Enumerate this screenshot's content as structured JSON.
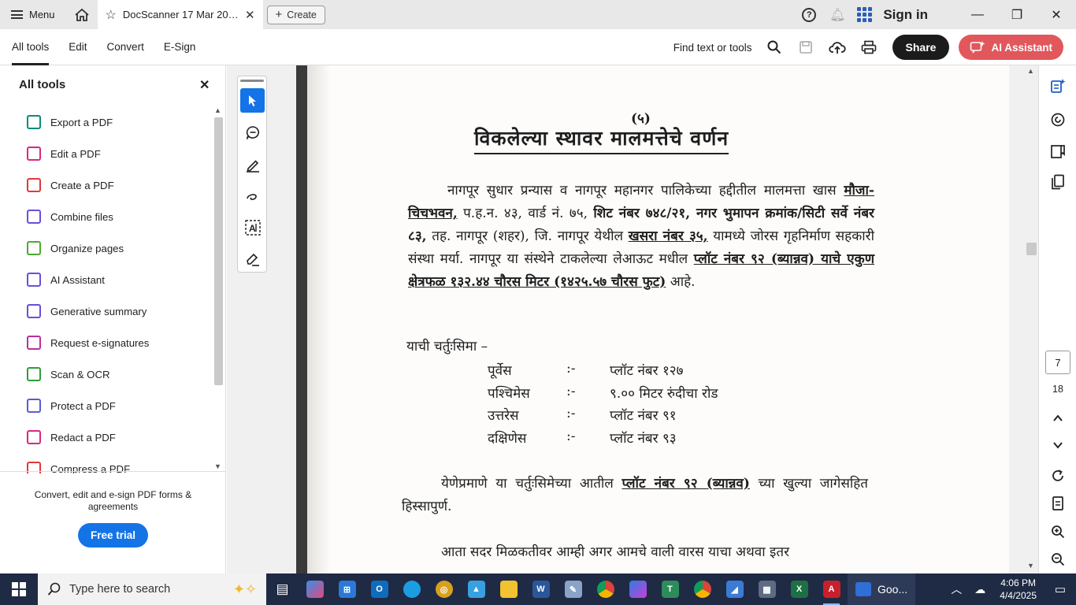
{
  "titlebar": {
    "menu_label": "Menu",
    "doc_tab_title": "DocScanner 17 Mar 202...",
    "create_label": "Create",
    "signin_label": "Sign in"
  },
  "toolbar": {
    "tabs": [
      {
        "label": "All tools",
        "active": true
      },
      {
        "label": "Edit",
        "active": false
      },
      {
        "label": "Convert",
        "active": false
      },
      {
        "label": "E-Sign",
        "active": false
      }
    ],
    "find_label": "Find text or tools",
    "share_label": "Share",
    "ai_label": "AI Assistant"
  },
  "sidebar": {
    "title": "All tools",
    "items": [
      {
        "label": "Export a PDF",
        "icon": "export-pdf-icon",
        "color": "#0e8a7a"
      },
      {
        "label": "Edit a PDF",
        "icon": "edit-pdf-icon",
        "color": "#d9287f"
      },
      {
        "label": "Create a PDF",
        "icon": "create-pdf-icon",
        "color": "#e03a3a"
      },
      {
        "label": "Combine files",
        "icon": "combine-files-icon",
        "color": "#6b4fd8"
      },
      {
        "label": "Organize pages",
        "icon": "organize-pages-icon",
        "color": "#4da832"
      },
      {
        "label": "AI Assistant",
        "icon": "ai-assistant-icon",
        "color": "#6b4fd8"
      },
      {
        "label": "Generative summary",
        "icon": "generative-summary-icon",
        "color": "#6b4fd8"
      },
      {
        "label": "Request e-signatures",
        "icon": "request-esign-icon",
        "color": "#b8329c"
      },
      {
        "label": "Scan & OCR",
        "icon": "scan-ocr-icon",
        "color": "#2e9d3a"
      },
      {
        "label": "Protect a PDF",
        "icon": "protect-pdf-icon",
        "color": "#5b5bd6"
      },
      {
        "label": "Redact a PDF",
        "icon": "redact-pdf-icon",
        "color": "#d9287f"
      },
      {
        "label": "Compress a PDF",
        "icon": "compress-pdf-icon",
        "color": "#e03a3a"
      }
    ],
    "footer_text": "Convert, edit and e-sign PDF forms & agreements",
    "trial_label": "Free trial"
  },
  "document": {
    "page_number_label": "(५)",
    "title": "विकलेल्या स्थावर मालमत्तेचे वर्णन",
    "para1_a": "नागपूर सुधार प्रन्यास व नागपूर महानगर पालिकेच्या हद्दीतील मालमत्ता खास ",
    "para1_b": "मौजा- चिचभवन,",
    "para1_c": " प.ह.न. ४३, वार्ड नं. ७५, ",
    "para1_d": "शिट नंबर ७४८/२१, नगर भुमापन क्रमांक/सिटी सर्वे नंबर ८३,",
    "para1_e": " तह. नागपूर (शहर), जि. नागपूर येथील ",
    "para1_f": "खसरा नंबर ३५,",
    "para1_g": " यामध्ये जोरस गृहनिर्माण सहकारी संस्था मर्या. नागपूर या संस्थेने टाकलेल्या लेआऊट मधील ",
    "para1_h": "प्लॉट नंबर ९२ (ब्यान्नव)  याचे एकुण क्षेत्रफळ १३२.४४ चौरस मिटर (१४२५.५७ चौरस फुट)",
    "para1_i": " आहे.",
    "bounds_head": "याची चर्तुःसिमा –",
    "bounds": [
      {
        "dir": "पूर्वेस",
        "sep": ":-",
        "val": "प्लॉट नंबर १२७"
      },
      {
        "dir": "पश्चिमेस",
        "sep": ":-",
        "val": "९.०० मिटर रुंदीचा रोड"
      },
      {
        "dir": "उत्तरेस",
        "sep": ":-",
        "val": "प्लॉट नंबर ९१"
      },
      {
        "dir": "दक्षिणेस",
        "sep": ":-",
        "val": "प्लॉट नंबर ९३"
      }
    ],
    "para2_a": "येणेप्रमाणे या चर्तुःसिमेच्या आतील ",
    "para2_b": "प्लॉट नंबर ९२ (ब्यान्नव)",
    "para2_c": " च्या खुल्या जागेसहित हिस्सापुर्ण.",
    "para3": "आता सदर मिळकतीवर आम्ही अगर आमचे वाली वारस याचा अथवा इतर"
  },
  "page_nav": {
    "current": "7",
    "total": "18"
  },
  "taskbar": {
    "search_placeholder": "Type here to search",
    "active_window_label": "Goo...",
    "time": "4:06 PM",
    "date": "4/4/2025"
  }
}
